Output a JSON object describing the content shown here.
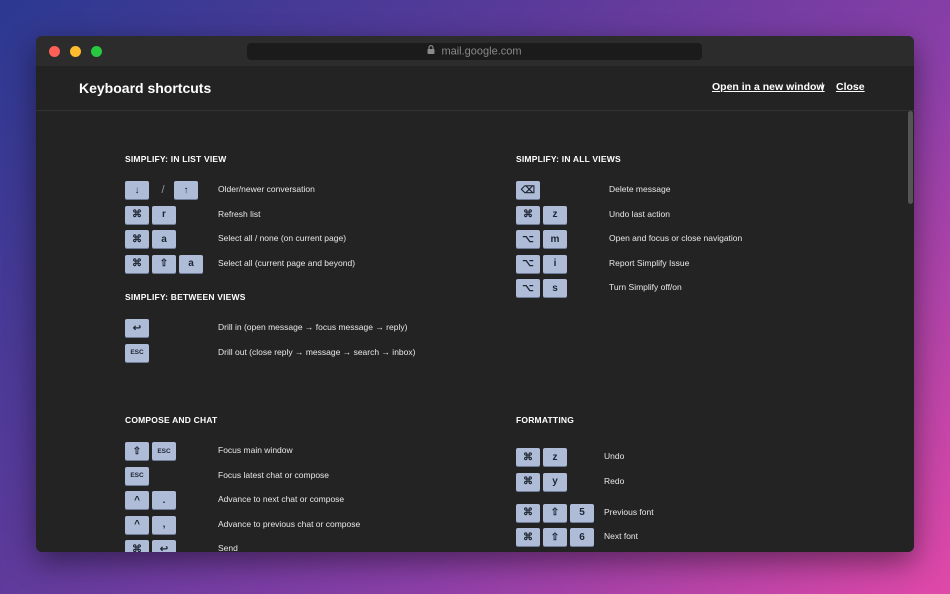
{
  "window": {
    "url": "mail.google.com"
  },
  "header": {
    "title": "Keyboard shortcuts",
    "open_new_window": "Open in a new window",
    "separator": "|",
    "close": "Close"
  },
  "sections": {
    "list_view": {
      "title": "SIMPLIFY: IN LIST VIEW",
      "rows": [
        {
          "keys": [
            "↓",
            "/",
            "↑"
          ],
          "desc": "Older/newer conversation"
        },
        {
          "keys": [
            "⌘",
            "r"
          ],
          "desc": "Refresh list"
        },
        {
          "keys": [
            "⌘",
            "a"
          ],
          "desc": "Select all / none (on current page)"
        },
        {
          "keys": [
            "⌘",
            "⇧",
            "a"
          ],
          "desc": "Select all (current page and beyond)"
        }
      ]
    },
    "between_views": {
      "title": "SIMPLIFY: BETWEEN VIEWS",
      "rows": [
        {
          "keys": [
            "↩"
          ],
          "desc": "Drill in (open message → focus message → reply)"
        },
        {
          "keys": [
            "ESC"
          ],
          "desc": "Drill out (close reply → message → search → inbox)"
        }
      ]
    },
    "all_views": {
      "title": "SIMPLIFY: IN ALL VIEWS",
      "rows": [
        {
          "keys": [
            "⌫"
          ],
          "desc": "Delete message"
        },
        {
          "keys": [
            "⌘",
            "z"
          ],
          "desc": "Undo last action"
        },
        {
          "keys": [
            "⌥",
            "m"
          ],
          "desc": "Open and focus or close navigation"
        },
        {
          "keys": [
            "⌥",
            "i"
          ],
          "desc": "Report Simplify Issue"
        },
        {
          "keys": [
            "⌥",
            "s"
          ],
          "desc": "Turn Simplify off/on"
        }
      ]
    },
    "compose_chat": {
      "title": "COMPOSE AND CHAT",
      "rows": [
        {
          "keys": [
            "⇧",
            "ESC"
          ],
          "desc": "Focus main window"
        },
        {
          "keys": [
            "ESC"
          ],
          "desc": "Focus latest chat or compose"
        },
        {
          "keys": [
            "^",
            "."
          ],
          "desc": "Advance to next chat or compose"
        },
        {
          "keys": [
            "^",
            ","
          ],
          "desc": "Advance to previous chat or compose"
        },
        {
          "keys": [
            "⌘",
            "↩"
          ],
          "desc": "Send"
        }
      ]
    },
    "formatting": {
      "title": "FORMATTING",
      "rows": [
        {
          "keys": [
            "⌘",
            "z"
          ],
          "desc": "Undo"
        },
        {
          "keys": [
            "⌘",
            "y"
          ],
          "desc": "Redo"
        },
        {
          "keys": [
            "⌘",
            "⇧",
            "5"
          ],
          "desc": "Previous font"
        },
        {
          "keys": [
            "⌘",
            "⇧",
            "6"
          ],
          "desc": "Next font"
        }
      ]
    }
  }
}
